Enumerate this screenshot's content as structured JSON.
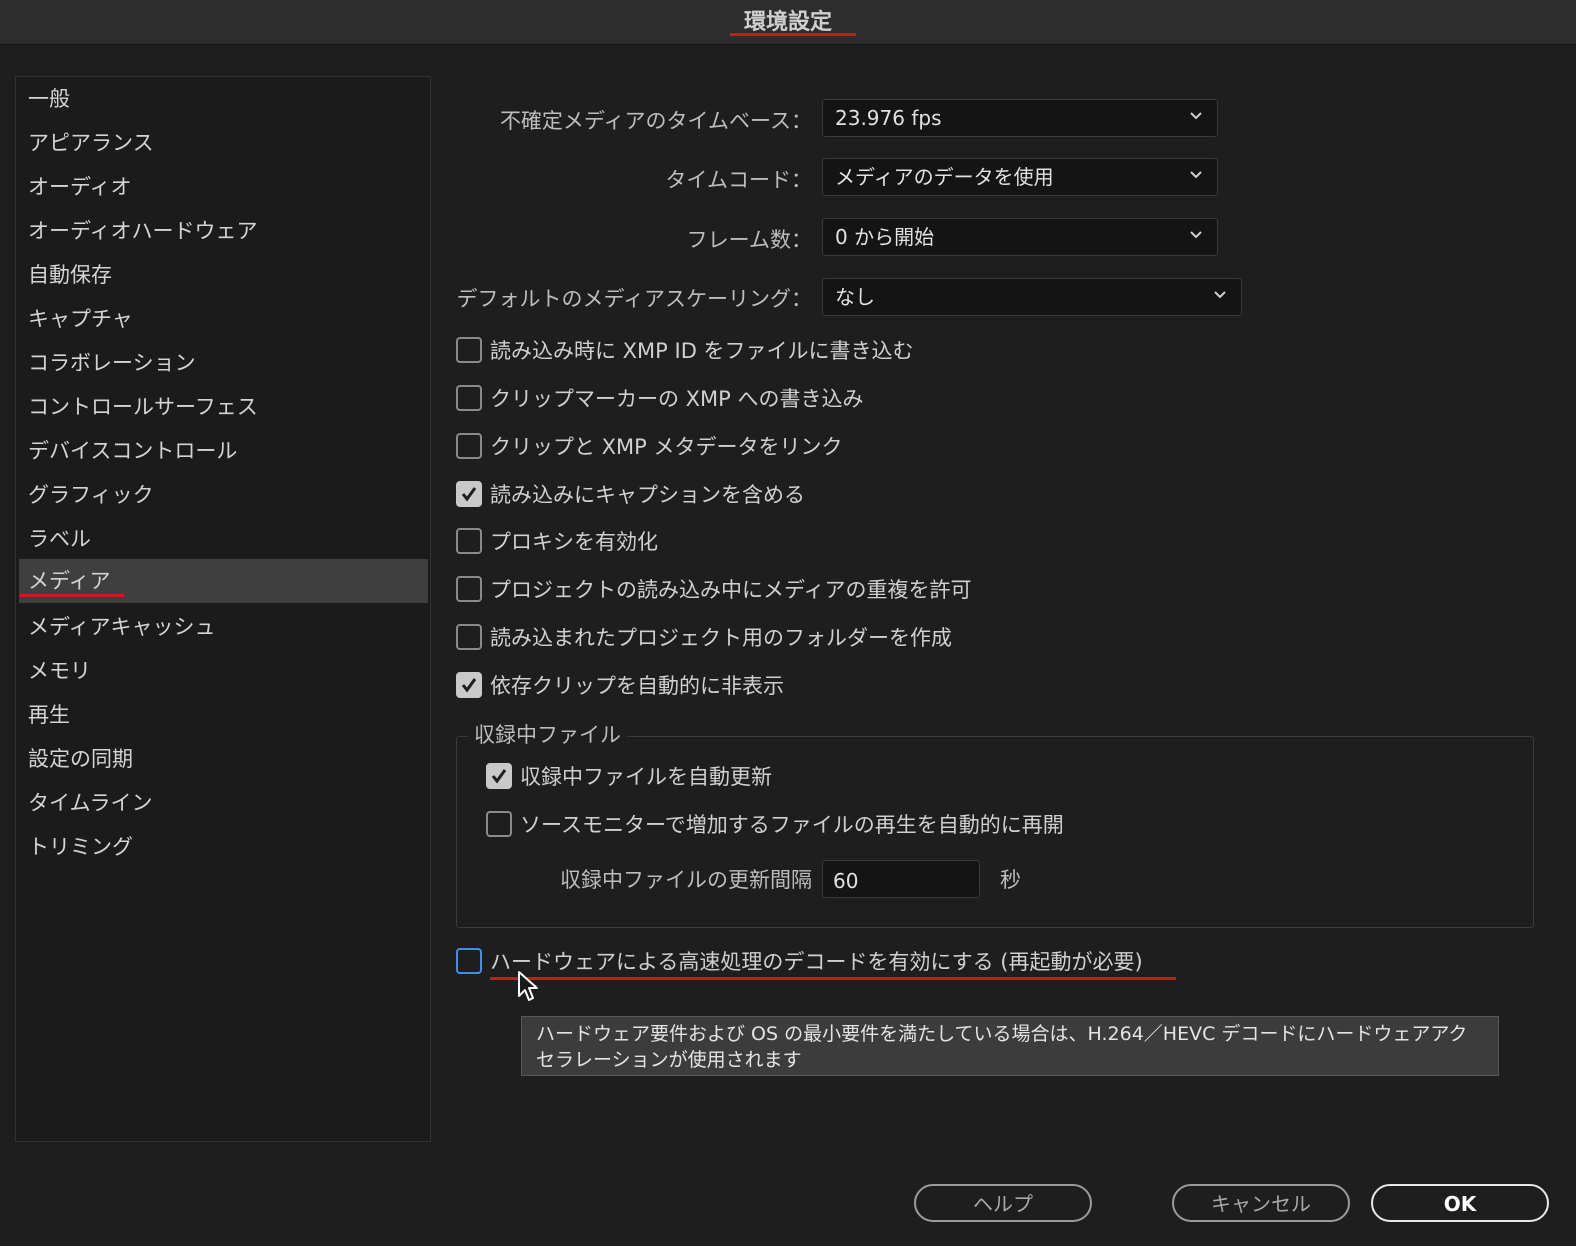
{
  "window": {
    "title": "環境設定"
  },
  "sidebar": {
    "items": [
      {
        "label": "一般"
      },
      {
        "label": "アピアランス"
      },
      {
        "label": "オーディオ"
      },
      {
        "label": "オーディオハードウェア"
      },
      {
        "label": "自動保存"
      },
      {
        "label": "キャプチャ"
      },
      {
        "label": "コラボレーション"
      },
      {
        "label": "コントロールサーフェス"
      },
      {
        "label": "デバイスコントロール"
      },
      {
        "label": "グラフィック"
      },
      {
        "label": "ラベル"
      },
      {
        "label": "メディア",
        "selected": true
      },
      {
        "label": "メディアキャッシュ"
      },
      {
        "label": "メモリ"
      },
      {
        "label": "再生"
      },
      {
        "label": "設定の同期"
      },
      {
        "label": "タイムライン"
      },
      {
        "label": "トリミング"
      }
    ]
  },
  "media": {
    "timebase": {
      "label": "不確定メディアのタイムベース：",
      "value": "23.976 fps"
    },
    "timecode": {
      "label": "タイムコード：",
      "value": "メディアのデータを使用"
    },
    "frame_count": {
      "label": "フレーム数：",
      "value": "0 から開始"
    },
    "scaling": {
      "label": "デフォルトのメディアスケーリング：",
      "value": "なし"
    },
    "checkboxes": [
      {
        "label": "読み込み時に XMP ID をファイルに書き込む",
        "checked": false
      },
      {
        "label": "クリップマーカーの XMP への書き込み",
        "checked": false
      },
      {
        "label": "クリップと XMP メタデータをリンク",
        "checked": false
      },
      {
        "label": "読み込みにキャプションを含める",
        "checked": true
      },
      {
        "label": "プロキシを有効化",
        "checked": false
      },
      {
        "label": "プロジェクトの読み込み中にメディアの重複を許可",
        "checked": false
      },
      {
        "label": "読み込まれたプロジェクト用のフォルダーを作成",
        "checked": false
      },
      {
        "label": "依存クリップを自動的に非表示",
        "checked": true
      }
    ],
    "growing_files": {
      "title": "収録中ファイル",
      "auto_refresh": {
        "label": "収録中ファイルを自動更新",
        "checked": true
      },
      "auto_resume": {
        "label": "ソースモニターで増加するファイルの再生を自動的に再開",
        "checked": false
      },
      "interval": {
        "label": "収録中ファイルの更新間隔",
        "value": "60",
        "unit": "秒"
      }
    },
    "hw_decode": {
      "label": "ハードウェアによる高速処理のデコードを有効にする (再起動が必要)",
      "checked": false
    },
    "tooltip": "ハードウェア要件および OS の最小要件を満たしている場合は、H.264／HEVC デコードにハードウェアアクセラレーションが使用されます"
  },
  "buttons": {
    "help": "ヘルプ",
    "cancel": "キャンセル",
    "ok": "OK"
  },
  "colors": {
    "annotation_red": "#d0171b",
    "focus_blue": "#3a8eff"
  }
}
